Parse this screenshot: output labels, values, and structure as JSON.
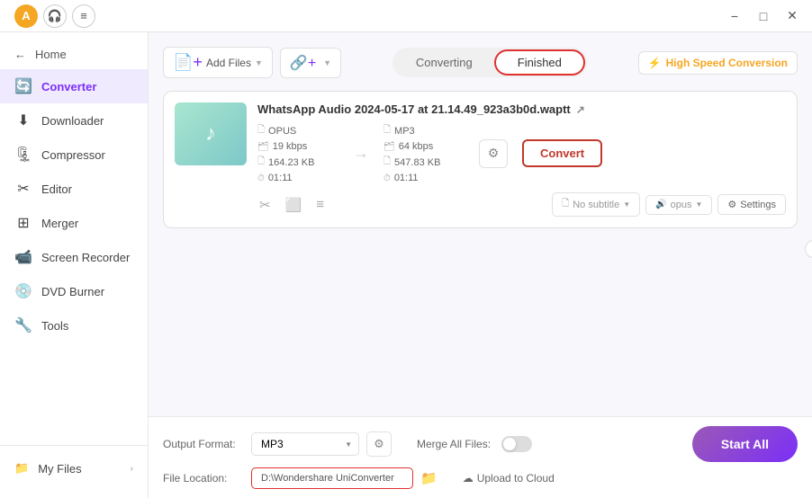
{
  "titlebar": {
    "avatar_text": "A",
    "minimize_label": "−",
    "maximize_label": "□",
    "close_label": "✕",
    "menu_label": "≡"
  },
  "sidebar": {
    "collapse_icon": "‹",
    "items": [
      {
        "id": "home",
        "label": "Home",
        "icon": "🏠"
      },
      {
        "id": "converter",
        "label": "Converter",
        "icon": "🔄",
        "active": true
      },
      {
        "id": "downloader",
        "label": "Downloader",
        "icon": "⬇"
      },
      {
        "id": "compressor",
        "label": "Compressor",
        "icon": "🗜"
      },
      {
        "id": "editor",
        "label": "Editor",
        "icon": "✂"
      },
      {
        "id": "merger",
        "label": "Merger",
        "icon": "⛙"
      },
      {
        "id": "screen-recorder",
        "label": "Screen Recorder",
        "icon": "📹"
      },
      {
        "id": "dvd-burner",
        "label": "DVD Burner",
        "icon": "💿"
      },
      {
        "id": "tools",
        "label": "Tools",
        "icon": "🔧"
      }
    ],
    "my_files": {
      "label": "My Files",
      "icon": "📁"
    }
  },
  "toolbar": {
    "add_file_label": "Add Files",
    "add_url_label": "Add URLs",
    "tab_converting": "Converting",
    "tab_finished": "Finished",
    "speed_label": "High Speed Conversion"
  },
  "file_card": {
    "filename": "WhatsApp Audio 2024-05-17 at 21.14.49_923a3b0d.waptt",
    "source": {
      "format": "OPUS",
      "bitrate": "19 kbps",
      "size": "164.23 KB",
      "duration": "01:11"
    },
    "target": {
      "format": "MP3",
      "bitrate": "64 kbps",
      "size": "547.83 KB",
      "duration": "01:11"
    },
    "convert_label": "Convert",
    "subtitle_label": "No subtitle",
    "audio_label": "opus",
    "settings_label": "Settings"
  },
  "bottom_bar": {
    "output_format_label": "Output Format:",
    "output_format_value": "MP3",
    "file_location_label": "File Location:",
    "file_location_value": "D:\\Wondershare UniConverter",
    "merge_label": "Merge All Files:",
    "upload_cloud_label": "Upload to Cloud",
    "start_all_label": "Start All"
  }
}
